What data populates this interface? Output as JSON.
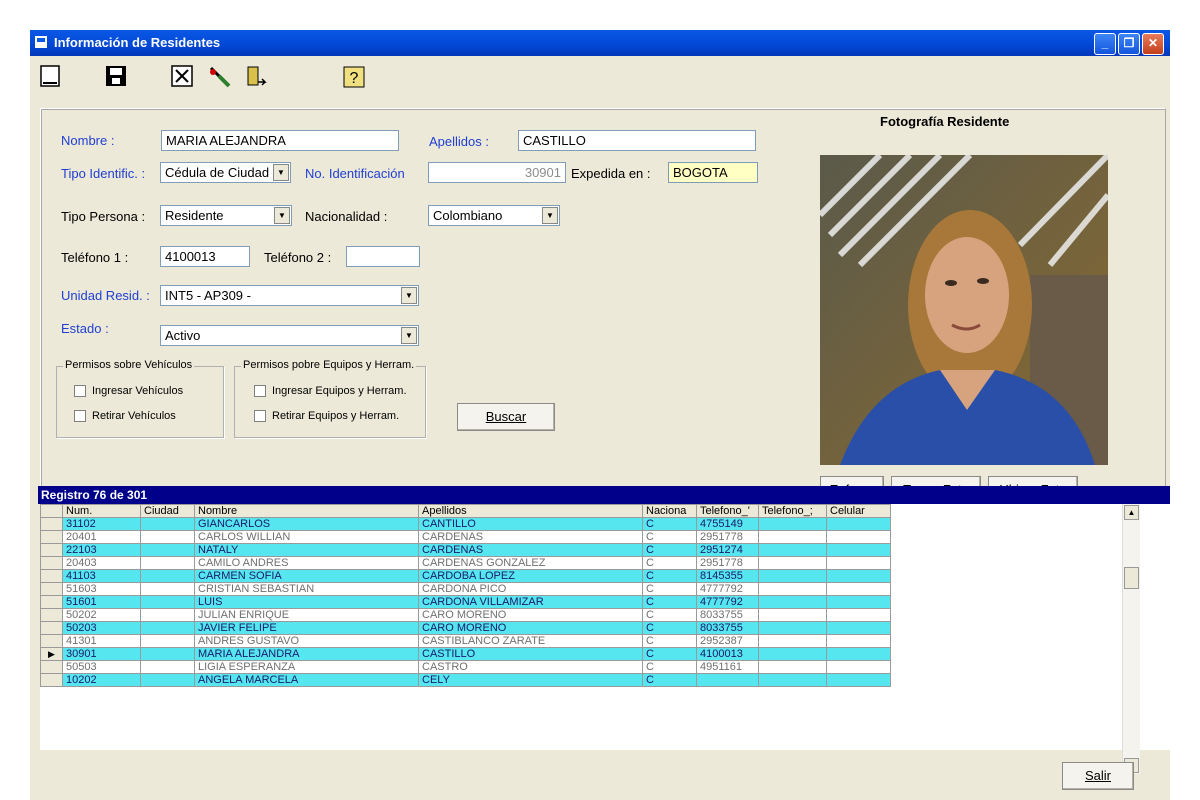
{
  "window": {
    "title": "Información de Residentes"
  },
  "toolbar": {
    "icons": [
      "new-icon",
      "save-icon",
      "delete-icon",
      "edit-icon",
      "exit-icon",
      "help-icon"
    ]
  },
  "form": {
    "nombre_label": "Nombre :",
    "nombre_value": "MARIA ALEJANDRA",
    "apellidos_label": "Apellidos :",
    "apellidos_value": "CASTILLO",
    "tipo_ident_label": "Tipo Identific. :",
    "tipo_ident_value": "Cédula de Ciudadanía",
    "no_ident_label": "No. Identificación",
    "no_ident_value": "30901",
    "expedida_label": "Expedida en :",
    "expedida_value": "BOGOTA",
    "tipo_persona_label": "Tipo Persona :",
    "tipo_persona_value": "Residente",
    "nacionalidad_label": "Nacionalidad :",
    "nacionalidad_value": "Colombiano",
    "telefono1_label": "Teléfono 1 :",
    "telefono1_value": "4100013",
    "telefono2_label": "Teléfono 2 :",
    "telefono2_value": "",
    "unidad_label": "Unidad Resid. :",
    "unidad_value": "INT5 - AP309 -",
    "estado_label": "Estado :",
    "estado_value": "Activo",
    "veh_group": "Permisos sobre Vehículos",
    "veh_ingresar": "Ingresar Vehículos",
    "veh_retirar": "Retirar Vehículos",
    "eq_group": "Permisos pobre Equipos y Herram.",
    "eq_ingresar": "Ingresar Equipos y Herram.",
    "eq_retirar": "Retirar Equipos y Herram.",
    "buscar": "Buscar"
  },
  "photo": {
    "title": "Fotografía Residente",
    "enfocar": "Enfocar",
    "tomar": "Tomar Foto",
    "ubicar": "Ubicar Foto"
  },
  "grid": {
    "record_label": "Registro 76 de 301",
    "columns": [
      "Num.",
      "Ciudad",
      "Nombre",
      "Apellidos",
      "Naciona",
      "Telefono_'",
      "Telefono_;",
      "Celular"
    ],
    "rows": [
      {
        "num": "31102",
        "ciudad": "",
        "nombre": "GIANCARLOS",
        "apellidos": "CANTILLO",
        "nac": "C",
        "tel1": "4755149",
        "tel2": "",
        "cel": "",
        "style": "cy"
      },
      {
        "num": "20401",
        "ciudad": "",
        "nombre": "CARLOS WILLIAN",
        "apellidos": "CARDENAS",
        "nac": "C",
        "tel1": "2951778",
        "tel2": "",
        "cel": "",
        "style": "wh"
      },
      {
        "num": "22103",
        "ciudad": "",
        "nombre": "NATALY",
        "apellidos": "CARDENAS",
        "nac": "C",
        "tel1": "2951274",
        "tel2": "",
        "cel": "",
        "style": "cy"
      },
      {
        "num": "20403",
        "ciudad": "",
        "nombre": "CAMILO ANDRES",
        "apellidos": "CARDENAS GONZALEZ",
        "nac": "C",
        "tel1": "2951778",
        "tel2": "",
        "cel": "",
        "style": "wh"
      },
      {
        "num": "41103",
        "ciudad": "",
        "nombre": "CARMEN SOFIA",
        "apellidos": "CARDOBA LOPEZ",
        "nac": "C",
        "tel1": "8145355",
        "tel2": "",
        "cel": "",
        "style": "cy"
      },
      {
        "num": "51603",
        "ciudad": "",
        "nombre": "CRISTIAN SEBASTIAN",
        "apellidos": "CARDONA PICO",
        "nac": "C",
        "tel1": "4777792",
        "tel2": "",
        "cel": "",
        "style": "wh"
      },
      {
        "num": "51601",
        "ciudad": "",
        "nombre": "LUIS",
        "apellidos": "CARDONA VILLAMIZAR",
        "nac": "C",
        "tel1": "4777792",
        "tel2": "",
        "cel": "",
        "style": "cy"
      },
      {
        "num": "50202",
        "ciudad": "",
        "nombre": "JULIAN ENRIQUE",
        "apellidos": "CARO MORENO",
        "nac": "C",
        "tel1": "8033755",
        "tel2": "",
        "cel": "",
        "style": "wh"
      },
      {
        "num": "50203",
        "ciudad": "",
        "nombre": "JAVIER FELIPE",
        "apellidos": "CARO MORENO",
        "nac": "C",
        "tel1": "8033755",
        "tel2": "",
        "cel": "",
        "style": "cy"
      },
      {
        "num": "41301",
        "ciudad": "",
        "nombre": "ANDRES GUSTAVO",
        "apellidos": "CASTIBLANCO ZARATE",
        "nac": "C",
        "tel1": "2952387",
        "tel2": "",
        "cel": "",
        "style": "wh"
      },
      {
        "num": "30901",
        "ciudad": "",
        "nombre": "MARIA ALEJANDRA",
        "apellidos": "CASTILLO",
        "nac": "C",
        "tel1": "4100013",
        "tel2": "",
        "cel": "",
        "style": "cy",
        "current": "▶"
      },
      {
        "num": "50503",
        "ciudad": "",
        "nombre": "LIGIA ESPERANZA",
        "apellidos": "CASTRO",
        "nac": "C",
        "tel1": "4951161",
        "tel2": "",
        "cel": "",
        "style": "wh"
      },
      {
        "num": "10202",
        "ciudad": "",
        "nombre": "ANGELA MARCELA",
        "apellidos": "CELY",
        "nac": "C",
        "tel1": "",
        "tel2": "",
        "cel": "",
        "style": "cy"
      }
    ]
  },
  "footer": {
    "salir": "Salir"
  }
}
